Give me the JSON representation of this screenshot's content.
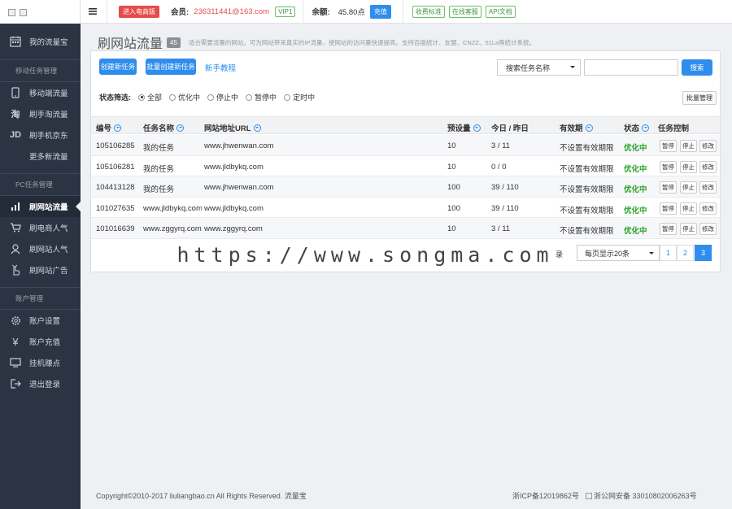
{
  "topbar": {
    "enter_btn": "进入电商版",
    "member_label": "会员:",
    "member_email": "236311441@163.com",
    "vip": "VIP1",
    "balance_label": "余额:",
    "balance": "45.80点",
    "recharge": "充值",
    "tags": [
      "收费标准",
      "在线客服",
      "API文档"
    ]
  },
  "sidebar": {
    "sec1": "我的流量宝",
    "mobile_title": "移动任务管理",
    "mobile_items": [
      {
        "label": "移动端流量",
        "icon": "phone-icon"
      },
      {
        "label": "刷手淘流量",
        "icon": "taobao-icon"
      },
      {
        "label": "刷手机京东",
        "icon": "jd-icon"
      },
      {
        "label": "更多新流量",
        "icon": ""
      }
    ],
    "pc_title": "PC任务管理",
    "pc_items": [
      {
        "label": "刷网站流量",
        "icon": "chart-icon"
      },
      {
        "label": "刷电商人气",
        "icon": "cart-icon"
      },
      {
        "label": "刷网站人气",
        "icon": "user-icon"
      },
      {
        "label": "刷网站广告",
        "icon": "hand-icon"
      }
    ],
    "acct_title": "账户管理",
    "acct_items": [
      {
        "label": "账户设置",
        "icon": "gear-icon"
      },
      {
        "label": "账户充值",
        "icon": "yen-icon"
      },
      {
        "label": "挂机赚点",
        "icon": "monitor-icon"
      },
      {
        "label": "退出登录",
        "icon": "logout-icon"
      }
    ]
  },
  "header": {
    "title": "刷网站流量",
    "count": "45",
    "desc": "适合需要流量的网站。可为网站带来真实的IP流量，使网站的访问量快速提高。支持百度统计、友盟、CNZZ、51La等统计系统。"
  },
  "toolbar": {
    "create": "创建新任务",
    "batch_create": "批量创建新任务",
    "tutorial": "新手教程",
    "search_select": "搜索任务名称",
    "search_btn": "搜索",
    "batch_manage": "批量管理"
  },
  "filter": {
    "label": "状态筛选:",
    "options": [
      "全部",
      "优化中",
      "停止中",
      "暂停中",
      "定时中"
    ],
    "selected": "全部"
  },
  "table": {
    "headers": [
      "编号",
      "任务名称",
      "网站地址URL",
      "预设量",
      "今日 / 昨日",
      "有效期",
      "状态",
      "任务控制"
    ],
    "rows": [
      {
        "id": "105106285",
        "name": "我的任务",
        "url": "www.jhwenwan.com",
        "preset": "10",
        "today": "3 / 11",
        "expire": "不设置有效期限",
        "status": "优化中"
      },
      {
        "id": "105106281",
        "name": "我的任务",
        "url": "www.jldbykq.com",
        "preset": "10",
        "today": "0 / 0",
        "expire": "不设置有效期限",
        "status": "优化中"
      },
      {
        "id": "104413128",
        "name": "我的任务",
        "url": "www.jhwenwan.com",
        "preset": "100",
        "today": "39 / 110",
        "expire": "不设置有效期限",
        "status": "优化中"
      },
      {
        "id": "101027635",
        "name": "www.jldbykq.com",
        "url": "www.jldbykq.com",
        "preset": "100",
        "today": "39 / 110",
        "expire": "不设置有效期限",
        "status": "优化中"
      },
      {
        "id": "101016639",
        "name": "www.zggyrq.com",
        "url": "www.zggyrq.com",
        "preset": "10",
        "today": "3 / 11",
        "expire": "不设置有效期限",
        "status": "优化中"
      }
    ],
    "actions": [
      "暂停",
      "停止",
      "修改"
    ]
  },
  "pager": {
    "records": "录",
    "page_size": "每页显示20条",
    "pages": [
      "1",
      "2",
      "3"
    ],
    "current": "3"
  },
  "watermark": "https://www.songma.com",
  "footer": {
    "copyright": "Copyright©2010-2017 liuliangbao.cn All Rights Reserved. 流量宝",
    "icp": "浙ICP备12019862号",
    "police": "浙公网安备 33010802006263号"
  }
}
